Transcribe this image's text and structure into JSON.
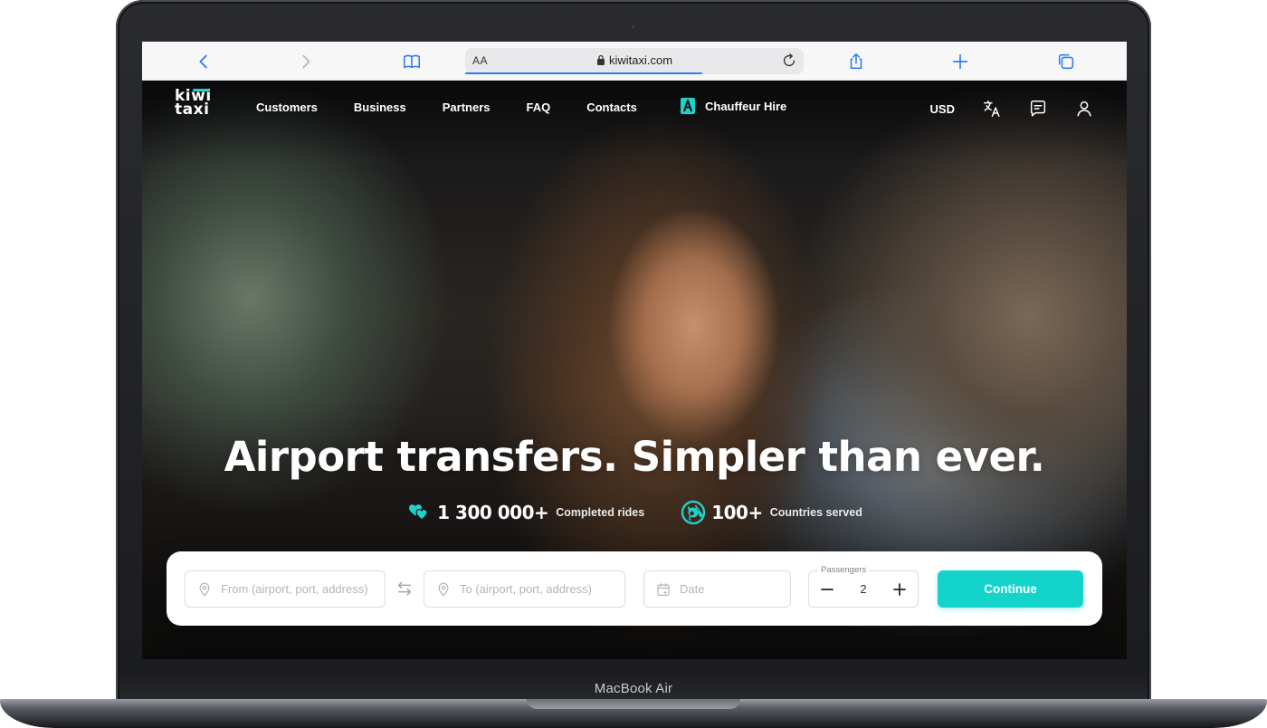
{
  "device": {
    "model_label": "MacBook Air"
  },
  "browser": {
    "reader_label": "AA",
    "url": "kiwitaxi.com"
  },
  "site": {
    "logo": {
      "line1": "kiwi",
      "line2": "taxi"
    },
    "nav": [
      {
        "label": "Customers"
      },
      {
        "label": "Business"
      },
      {
        "label": "Partners"
      },
      {
        "label": "FAQ"
      },
      {
        "label": "Contacts"
      }
    ],
    "chauffeur_label": "Chauffeur Hire",
    "currency": "USD"
  },
  "hero": {
    "headline": "Airport transfers. Simpler than ever.",
    "stats": [
      {
        "value": "1 300 000+",
        "label": "Completed rides",
        "icon": "hearts-icon"
      },
      {
        "value": "100+",
        "label": "Countries served",
        "icon": "globe-icon"
      }
    ]
  },
  "search": {
    "from_placeholder": "From (airport, port, address)",
    "to_placeholder": "To (airport, port, address)",
    "date_placeholder": "Date",
    "passengers_label": "Passengers",
    "passengers_value": "2",
    "continue_label": "Continue"
  },
  "colors": {
    "accent": "#14d3cb",
    "progress": "#2f7cf6"
  }
}
